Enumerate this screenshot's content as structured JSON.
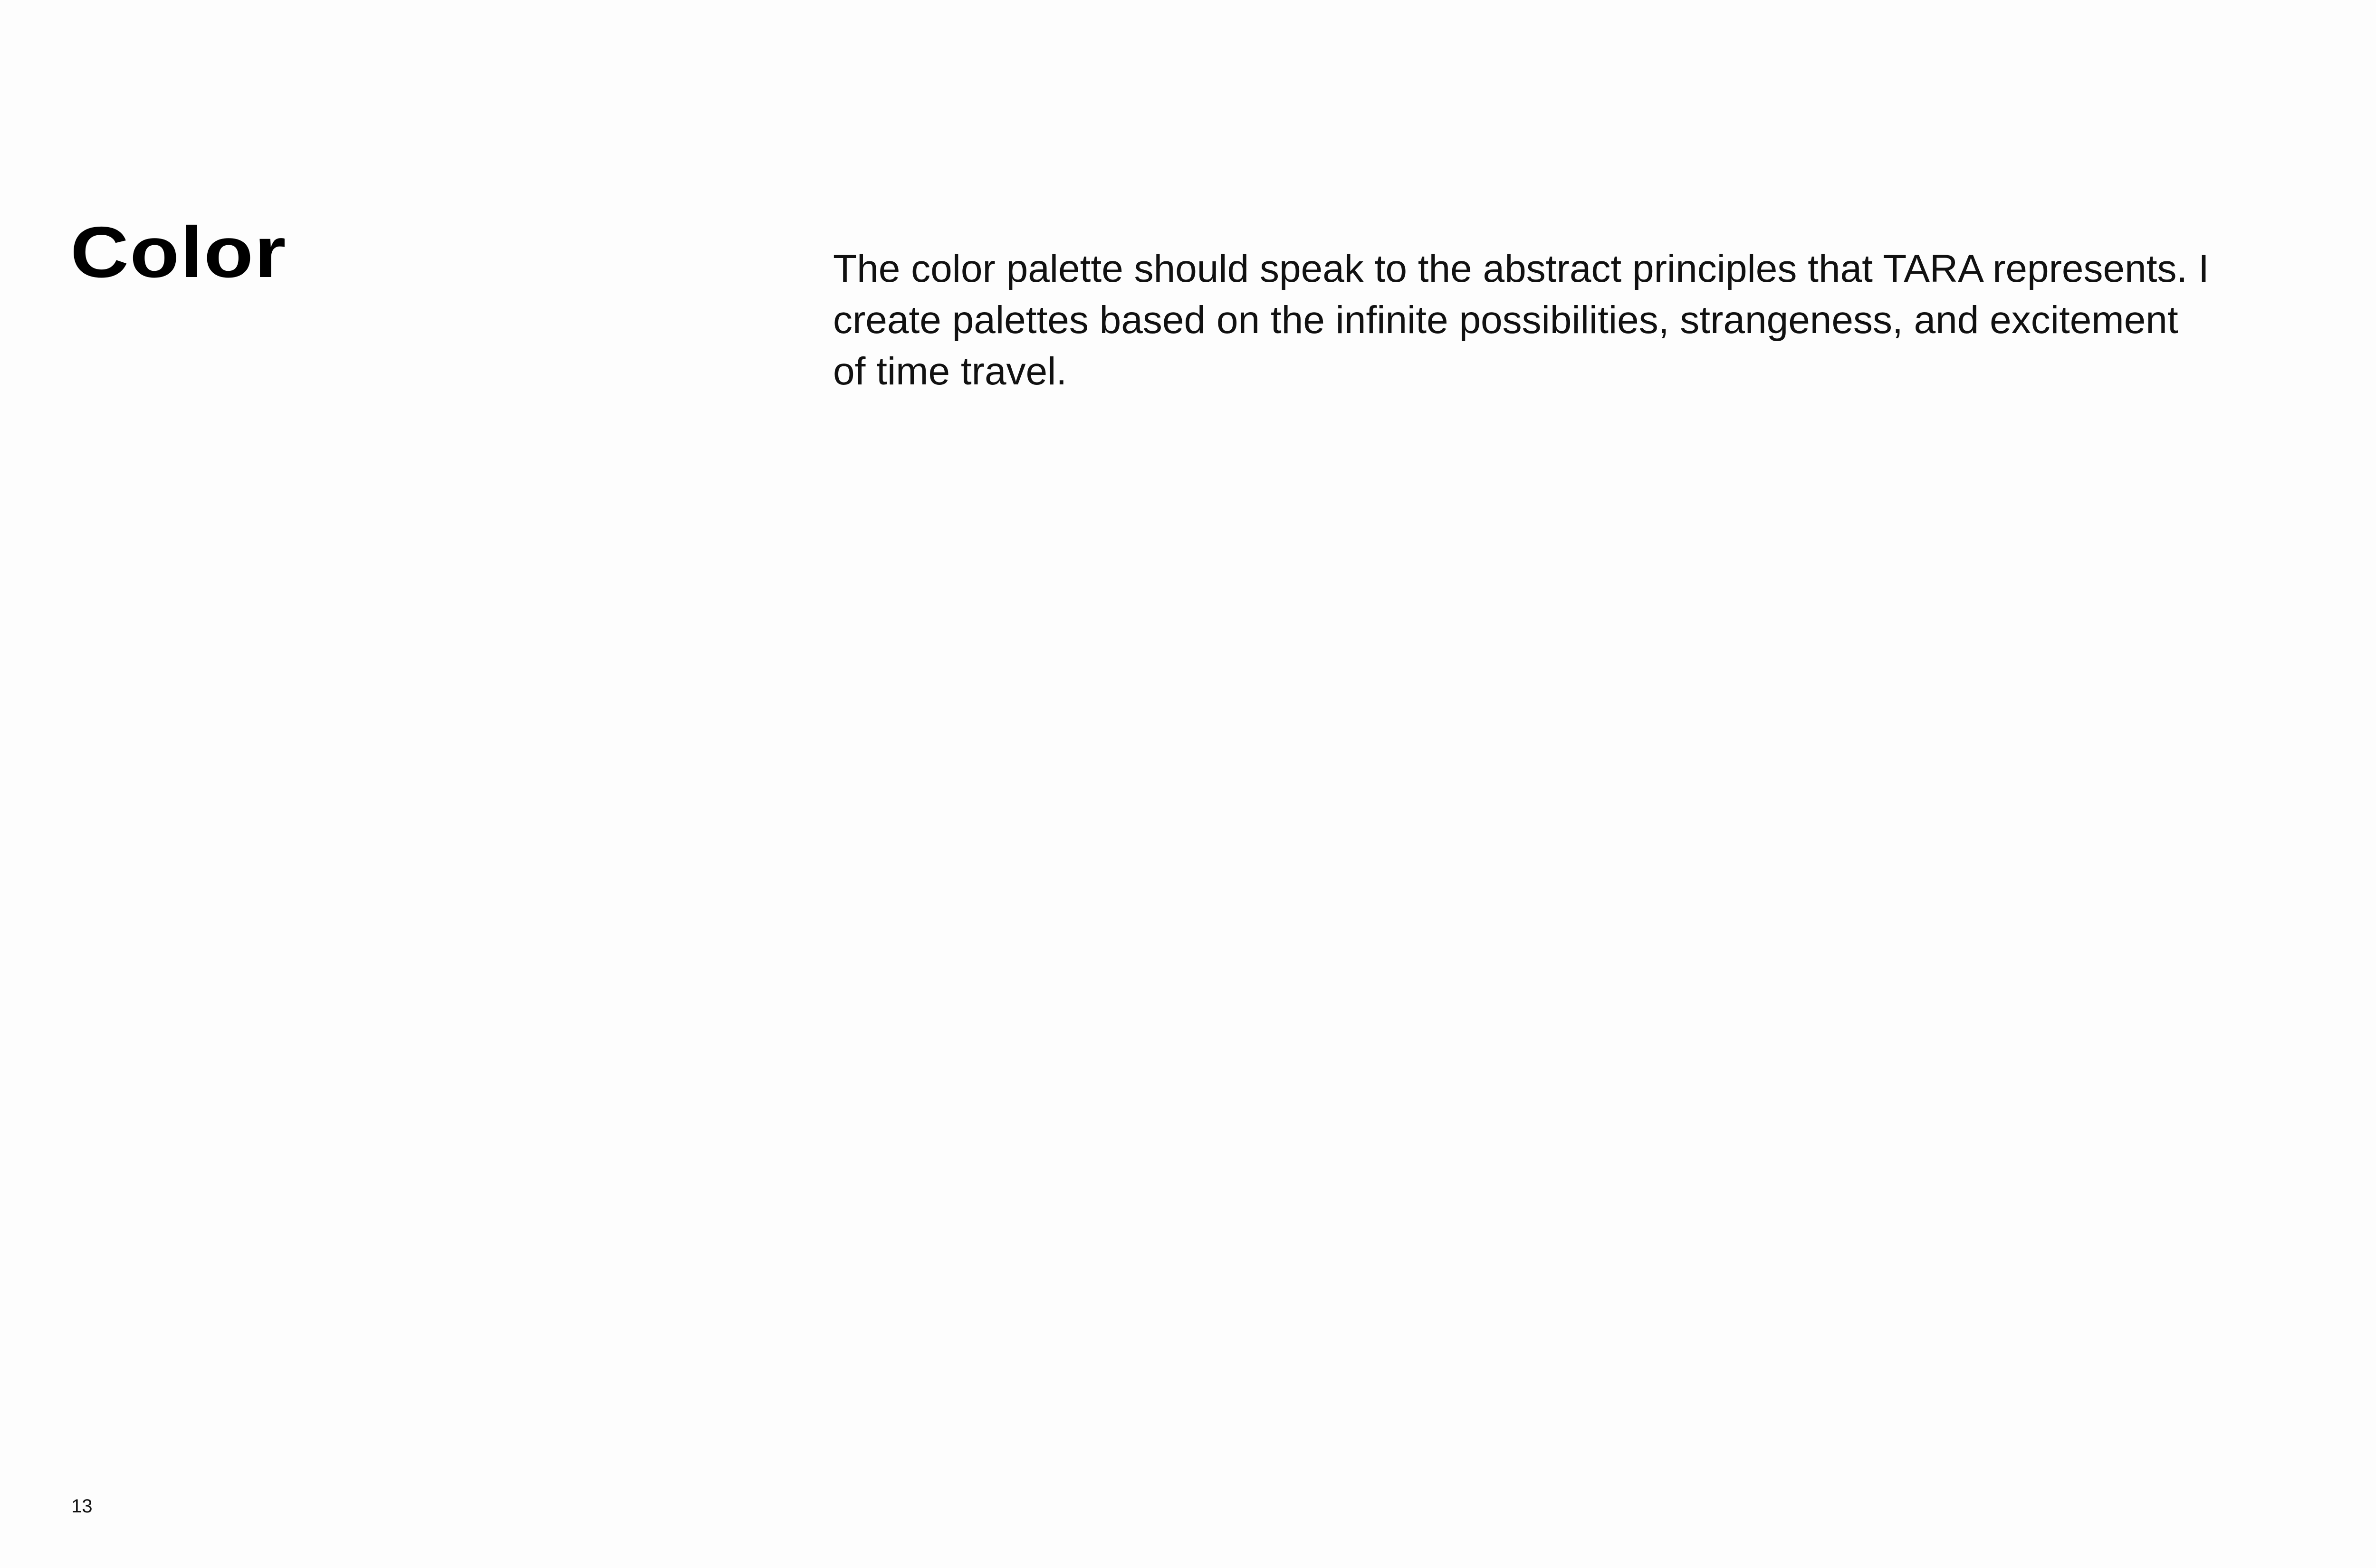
{
  "page": {
    "title": "Color",
    "body": "The color palette should speak to the abstract principles that TARA represents. I create palettes based on the infinite possibilities, strangeness, and excitement of time travel.",
    "page_number": "13"
  },
  "colors": {
    "background": "#fdfdfd",
    "text": "#000000"
  }
}
